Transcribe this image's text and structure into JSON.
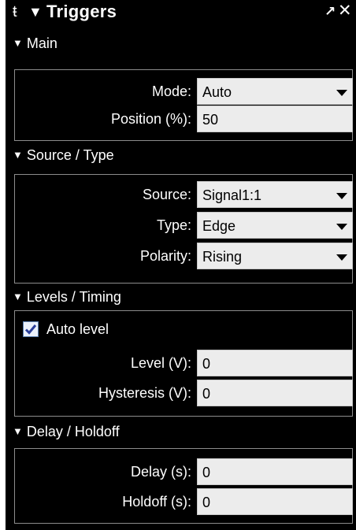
{
  "window": {
    "title": "Triggers",
    "pin_glyph": "⍖",
    "menu_glyph": "▼",
    "undock_glyph": "➚",
    "close_glyph": "✕"
  },
  "sections": {
    "main": {
      "header": "Main",
      "mode": {
        "label": "Mode:",
        "value": "Auto"
      },
      "position": {
        "label": "Position (%):",
        "value": "50"
      }
    },
    "source_type": {
      "header": "Source / Type",
      "source": {
        "label": "Source:",
        "value": "Signal1:1"
      },
      "type": {
        "label": "Type:",
        "value": "Edge"
      },
      "polarity": {
        "label": "Polarity:",
        "value": "Rising"
      }
    },
    "levels_timing": {
      "header": "Levels / Timing",
      "auto_level": {
        "label": "Auto level",
        "checked": true
      },
      "level": {
        "label": "Level (V):",
        "value": "0"
      },
      "hysteresis": {
        "label": "Hysteresis (V):",
        "value": "0"
      }
    },
    "delay_holdoff": {
      "header": "Delay / Holdoff",
      "delay": {
        "label": "Delay (s):",
        "value": "0"
      },
      "holdoff": {
        "label": "Holdoff (s):",
        "value": "0"
      }
    }
  },
  "icons": {
    "section_toggle": "triangle-down-icon",
    "dropdown": "dropdown-arrow-icon",
    "check": "checkmark-icon"
  }
}
